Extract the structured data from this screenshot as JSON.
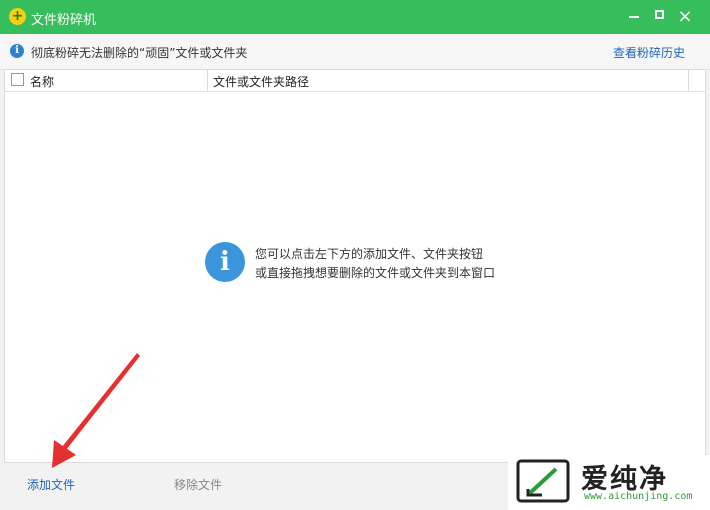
{
  "window": {
    "title": "文件粉碎机",
    "app_icon": "plus-coin-icon",
    "controls": [
      "minimize-icon",
      "maximize-icon",
      "close-icon"
    ],
    "close_glyph": "×"
  },
  "infobar": {
    "icon": "info-icon",
    "text": "彻底粉碎无法删除的“顽固”文件或文件夹",
    "history_link": "查看粉碎历史"
  },
  "list": {
    "columns": [
      "名称",
      "文件或文件夹路径"
    ],
    "empty_hint": {
      "icon": "info-icon",
      "line1": "您可以点击左下方的添加文件、文件夹按钮",
      "line2": "或直接拖拽想要删除的文件或文件夹到本窗口"
    }
  },
  "bottom": {
    "add_file": "添加文件",
    "remove_file": "移除文件"
  },
  "watermark": {
    "brand": "爱纯净",
    "url": "www.aichunjing.com"
  },
  "colors": {
    "titlebar": "#36bd5c",
    "link": "#2266bb",
    "info_blue": "#3a95dd",
    "annotation_arrow": "#e53030",
    "watermark_green": "#2c9c38"
  }
}
